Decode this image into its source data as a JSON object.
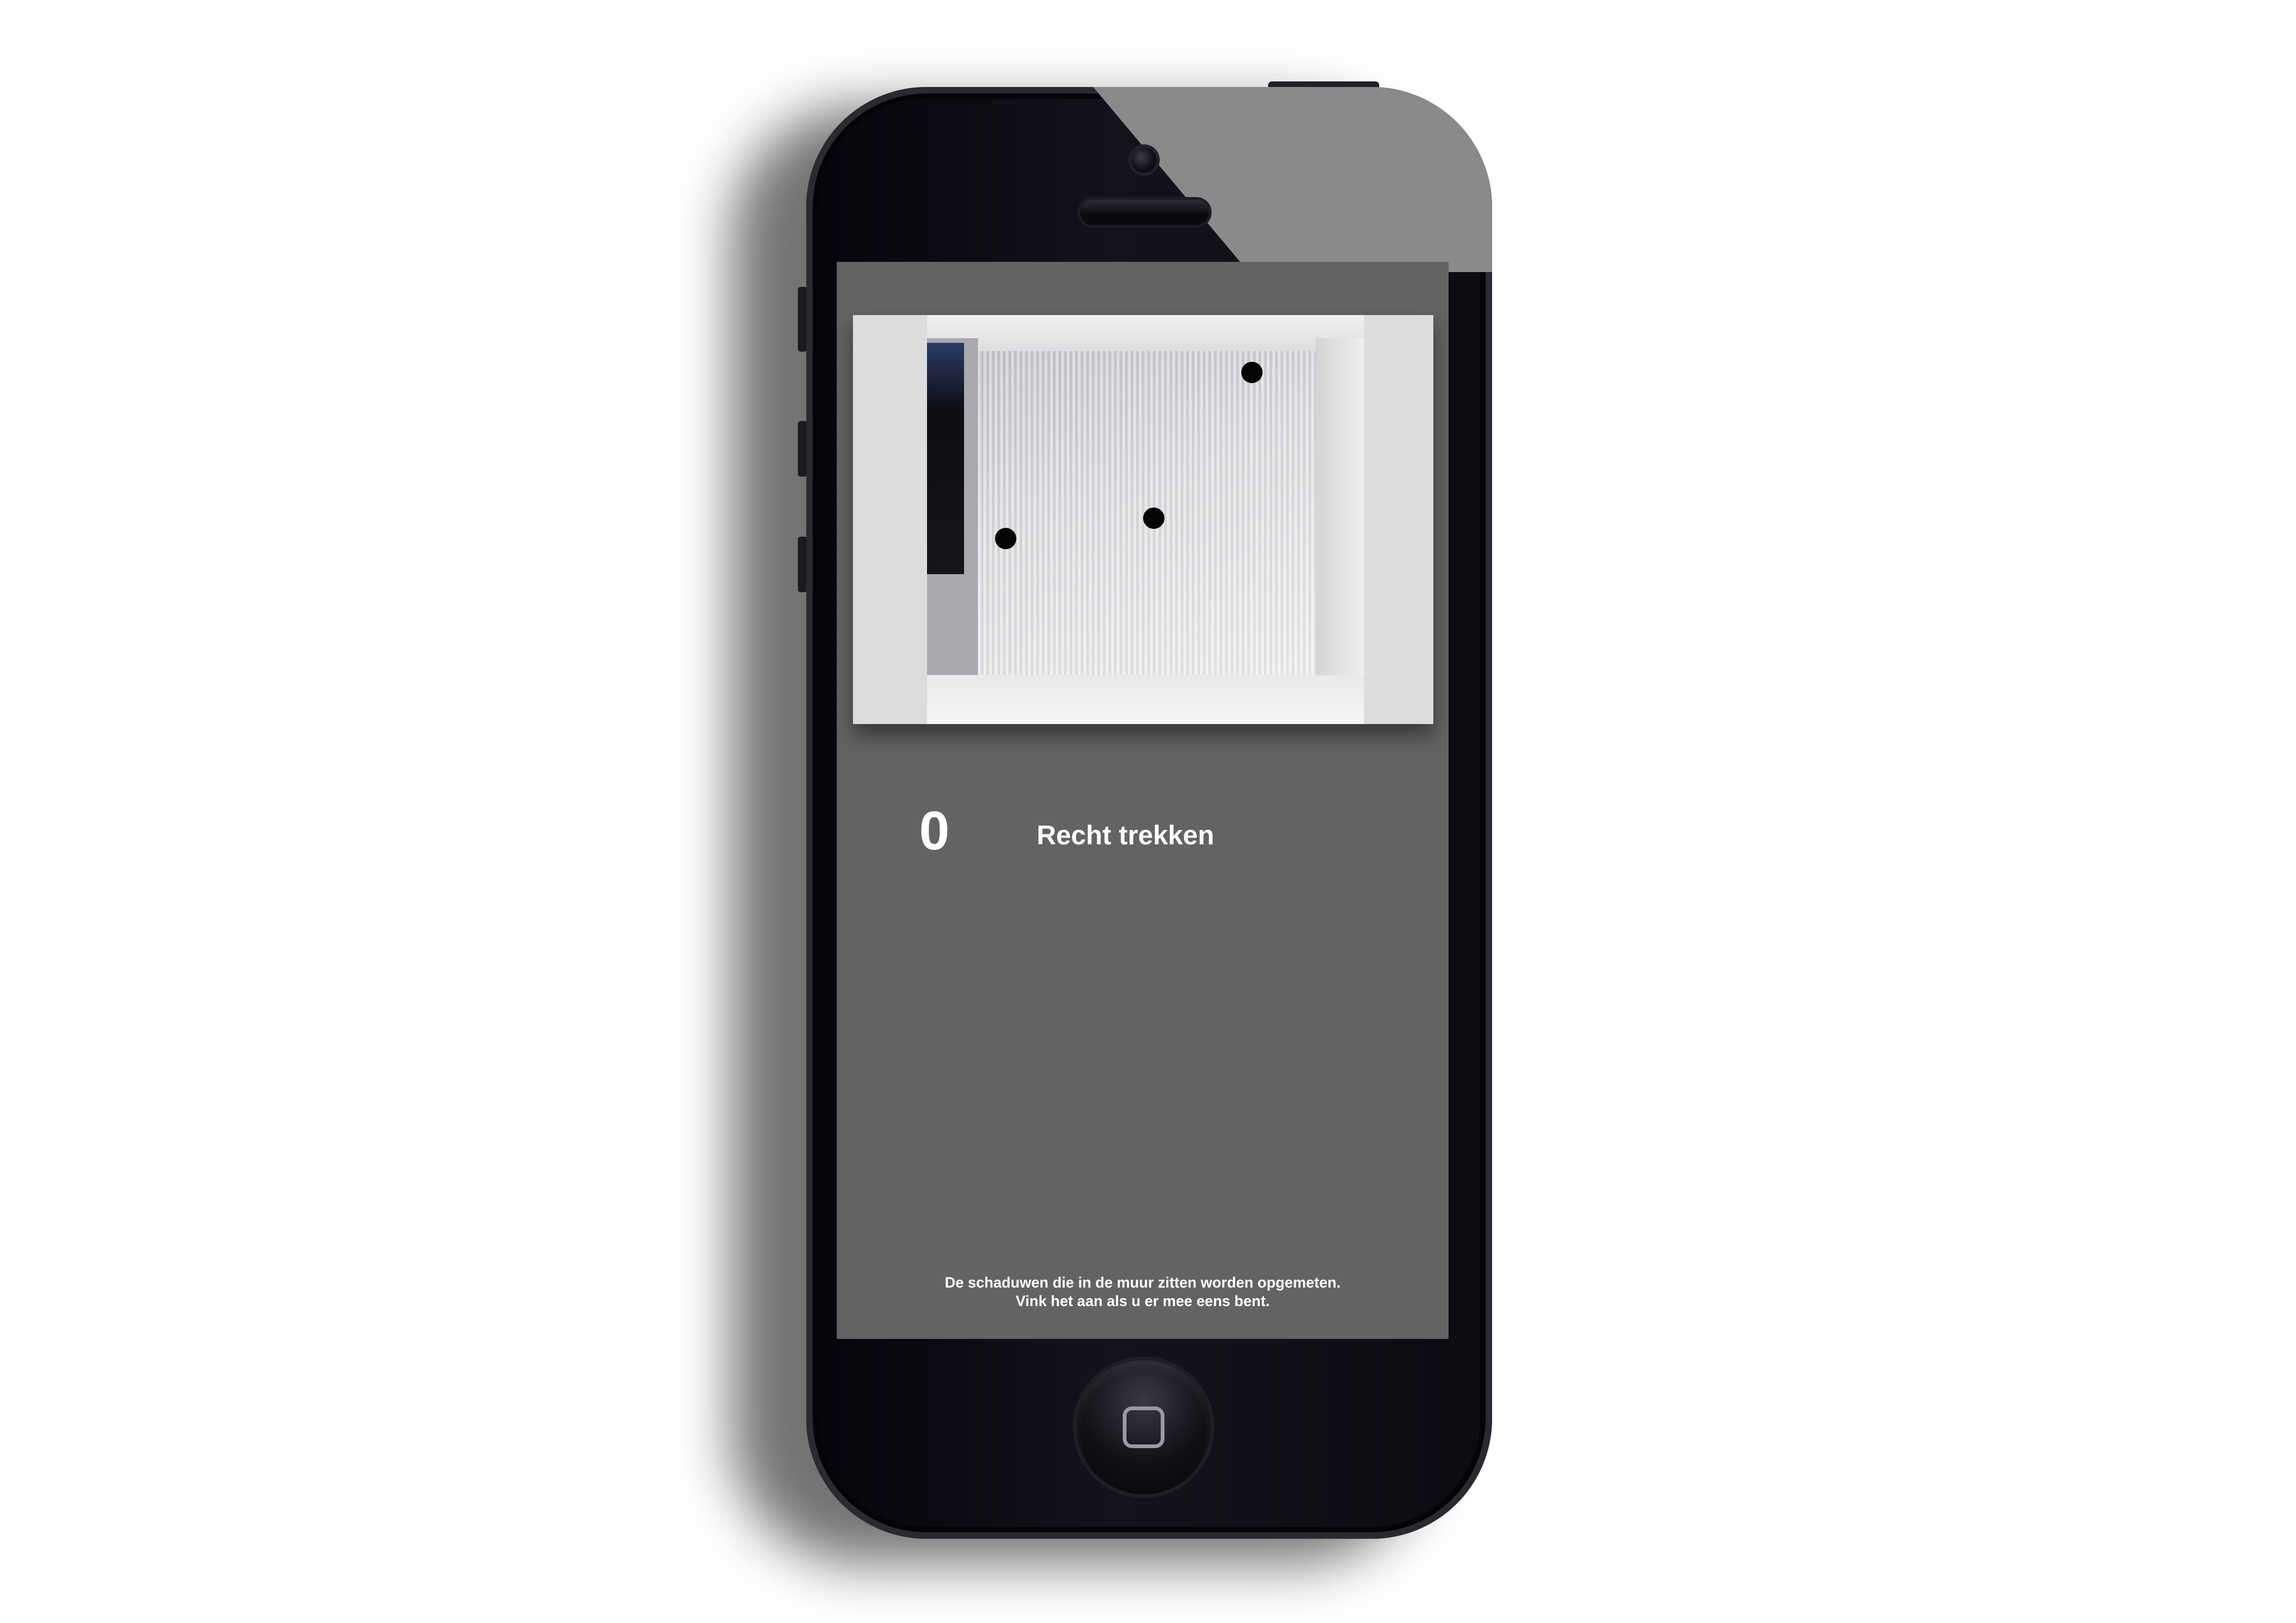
{
  "step": {
    "number": "0",
    "title": "Recht trekken"
  },
  "instructions": {
    "line1": "De schaduwen die in de muur zitten worden opgemeten.",
    "line2": "Vink het aan als u er mee eens bent."
  },
  "colors": {
    "screen_background": "#636363",
    "text": "#ffffff",
    "marker": "#050505"
  },
  "icons": {
    "home": "home-button-icon",
    "camera": "front-camera-icon",
    "speaker": "earpiece-speaker-icon"
  }
}
